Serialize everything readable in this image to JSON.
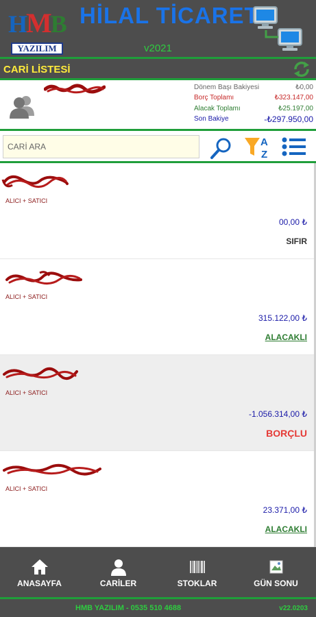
{
  "header": {
    "logo_hmb_h": "H",
    "logo_hmb_m": "M",
    "logo_hmb_b": "B",
    "logo_yazilim": "YAZILIM",
    "title": "HİLAL TİCARET",
    "version": "v2021",
    "network_icon": "network-computers-icon"
  },
  "section": {
    "title": "CARİ LİSTESİ",
    "refresh_icon": "refresh-icon"
  },
  "summary": {
    "avatar_icon": "person-icon",
    "rows": [
      {
        "label": "Dönem Başı Bakiyesi",
        "value": "₺0,00",
        "label_color": "#666666",
        "value_color": "#666666"
      },
      {
        "label": "Borç Toplamı",
        "value": "₺323.147,00",
        "label_color": "#c62828",
        "value_color": "#c62828"
      },
      {
        "label": "Alacak Toplamı",
        "value": "₺25.197,00",
        "label_color": "#2e7d32",
        "value_color": "#2e7d32"
      },
      {
        "label": "Son Bakiye",
        "value": "-₺297.950,00",
        "label_color": "#1a1aa8",
        "value_color": "#1a1aa8"
      }
    ]
  },
  "search": {
    "placeholder": "CARİ ARA",
    "value": ""
  },
  "list": {
    "items": [
      {
        "type": "ALICI + SATICI",
        "amount": "00,00 ₺",
        "status": "SIFIR",
        "status_color": "#333333"
      },
      {
        "type": "ALICI + SATICI",
        "amount": "315.122,00 ₺",
        "status": "ALACAKLI",
        "status_color": "#2e7d32"
      },
      {
        "type": "ALICI + SATICI",
        "amount": "-1.056.314,00 ₺",
        "status": "BORÇLU",
        "status_color": "#e53935"
      },
      {
        "type": "ALICI + SATICI",
        "amount": "23.371,00 ₺",
        "status": "ALACAKLI",
        "status_color": "#2e7d32"
      }
    ]
  },
  "nav": {
    "items": [
      {
        "label": "ANASAYFA",
        "icon": "home-icon"
      },
      {
        "label": "CARİLER",
        "icon": "person-icon"
      },
      {
        "label": "STOKLAR",
        "icon": "barcode-icon"
      },
      {
        "label": "GÜN SONU",
        "icon": "broken-image-icon"
      }
    ]
  },
  "footer": {
    "text": "HMB YAZILIM - 0535 510 4688",
    "version": "v22.0203"
  },
  "colors": {
    "bar_bg": "#4d4d4d",
    "accent_green": "#1f9e3a",
    "title_blue": "#1a73e8",
    "section_yellow": "#ffeb3b"
  }
}
